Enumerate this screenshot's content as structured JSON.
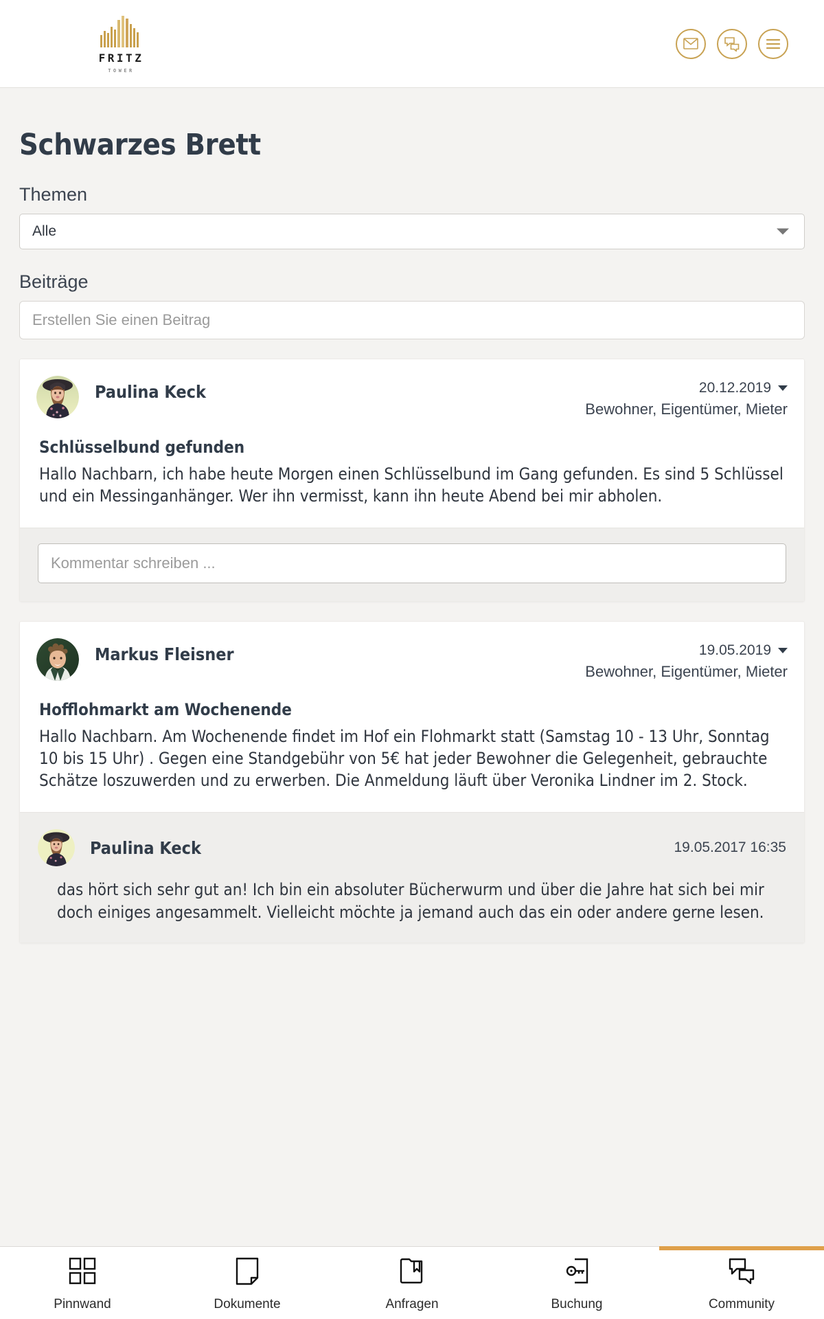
{
  "header": {
    "logo": {
      "word": "FRITZ",
      "sub": "TOWER",
      "icon": "tower-logo-icon"
    },
    "actions": [
      {
        "name": "mail-icon",
        "label": "Nachrichten"
      },
      {
        "name": "chat-icon",
        "label": "Chat"
      },
      {
        "name": "menu-icon",
        "label": "Menü"
      }
    ],
    "accent_color": "#c8a253"
  },
  "page": {
    "title": "Schwarzes Brett"
  },
  "filter": {
    "label": "Themen",
    "selected": "Alle",
    "options": [
      "Alle"
    ]
  },
  "posts_section": {
    "label": "Beiträge",
    "create_placeholder": "Erstellen Sie einen Beitrag"
  },
  "posts": [
    {
      "author": "Paulina Keck",
      "date": "20.12.2019",
      "roles": "Bewohner, Eigentümer, Mieter",
      "title": "Schlüsselbund gefunden",
      "body": "Hallo Nachbarn, ich habe heute Morgen einen Schlüsselbund im Gang gefunden. Es sind 5 Schlüssel und ein Messinganhänger. Wer ihn vermisst, kann ihn heute Abend bei mir abholen.",
      "comment_placeholder": "Kommentar schreiben ...",
      "comments": []
    },
    {
      "author": "Markus Fleisner",
      "date": "19.05.2019",
      "roles": "Bewohner, Eigentümer, Mieter",
      "title": "Hofflohmarkt am Wochenende",
      "body": "Hallo Nachbarn. Am Wochenende findet im Hof ein Flohmarkt statt (Samstag 10 - 13 Uhr, Sonntag 10 bis 15 Uhr) . Gegen eine Standgebühr von 5€ hat jeder Bewohner die Gelegenheit, gebrauchte Schätze loszuwerden und zu erwerben. Die Anmeldung läuft über Veronika Lindner im 2. Stock.",
      "comments": [
        {
          "author": "Paulina Keck",
          "time": "19.05.2017 16:35",
          "body": "das hört sich sehr gut an! Ich bin ein absoluter Bücherwurm und über die Jahre hat sich bei mir doch einiges angesammelt. Vielleicht möchte ja jemand auch das ein oder andere gerne lesen."
        }
      ]
    }
  ],
  "bottom_nav": {
    "active_color": "#dfa04a",
    "items": [
      {
        "label": "Pinnwand",
        "icon": "grid-icon",
        "active": false
      },
      {
        "label": "Dokumente",
        "icon": "document-icon",
        "active": false
      },
      {
        "label": "Anfragen",
        "icon": "folder-bookmark-icon",
        "active": false
      },
      {
        "label": "Buchung",
        "icon": "key-door-icon",
        "active": false
      },
      {
        "label": "Community",
        "icon": "chat-bubbles-icon",
        "active": true
      }
    ]
  }
}
